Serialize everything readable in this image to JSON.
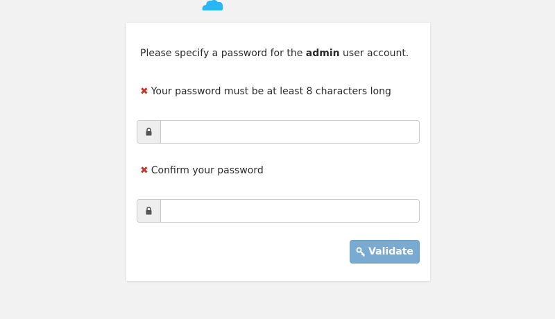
{
  "logo": {
    "icon": "cloud-icon",
    "color": "#29b6f6"
  },
  "form": {
    "intro_prefix": "Please specify a password for the ",
    "intro_user": "admin",
    "intro_suffix": " user account.",
    "requirements": [
      {
        "icon": "cross-icon",
        "text": "Your password must be at least 8 characters long",
        "status_color": "#c0392b"
      },
      {
        "icon": "cross-icon",
        "text": "Confirm your password",
        "status_color": "#c0392b"
      }
    ],
    "password_field": {
      "icon": "lock-icon",
      "value": "",
      "placeholder": ""
    },
    "confirm_field": {
      "icon": "lock-icon",
      "value": "",
      "placeholder": ""
    },
    "validate_button": {
      "icon": "key-icon",
      "label": "Validate",
      "color": "#79abd2"
    }
  }
}
